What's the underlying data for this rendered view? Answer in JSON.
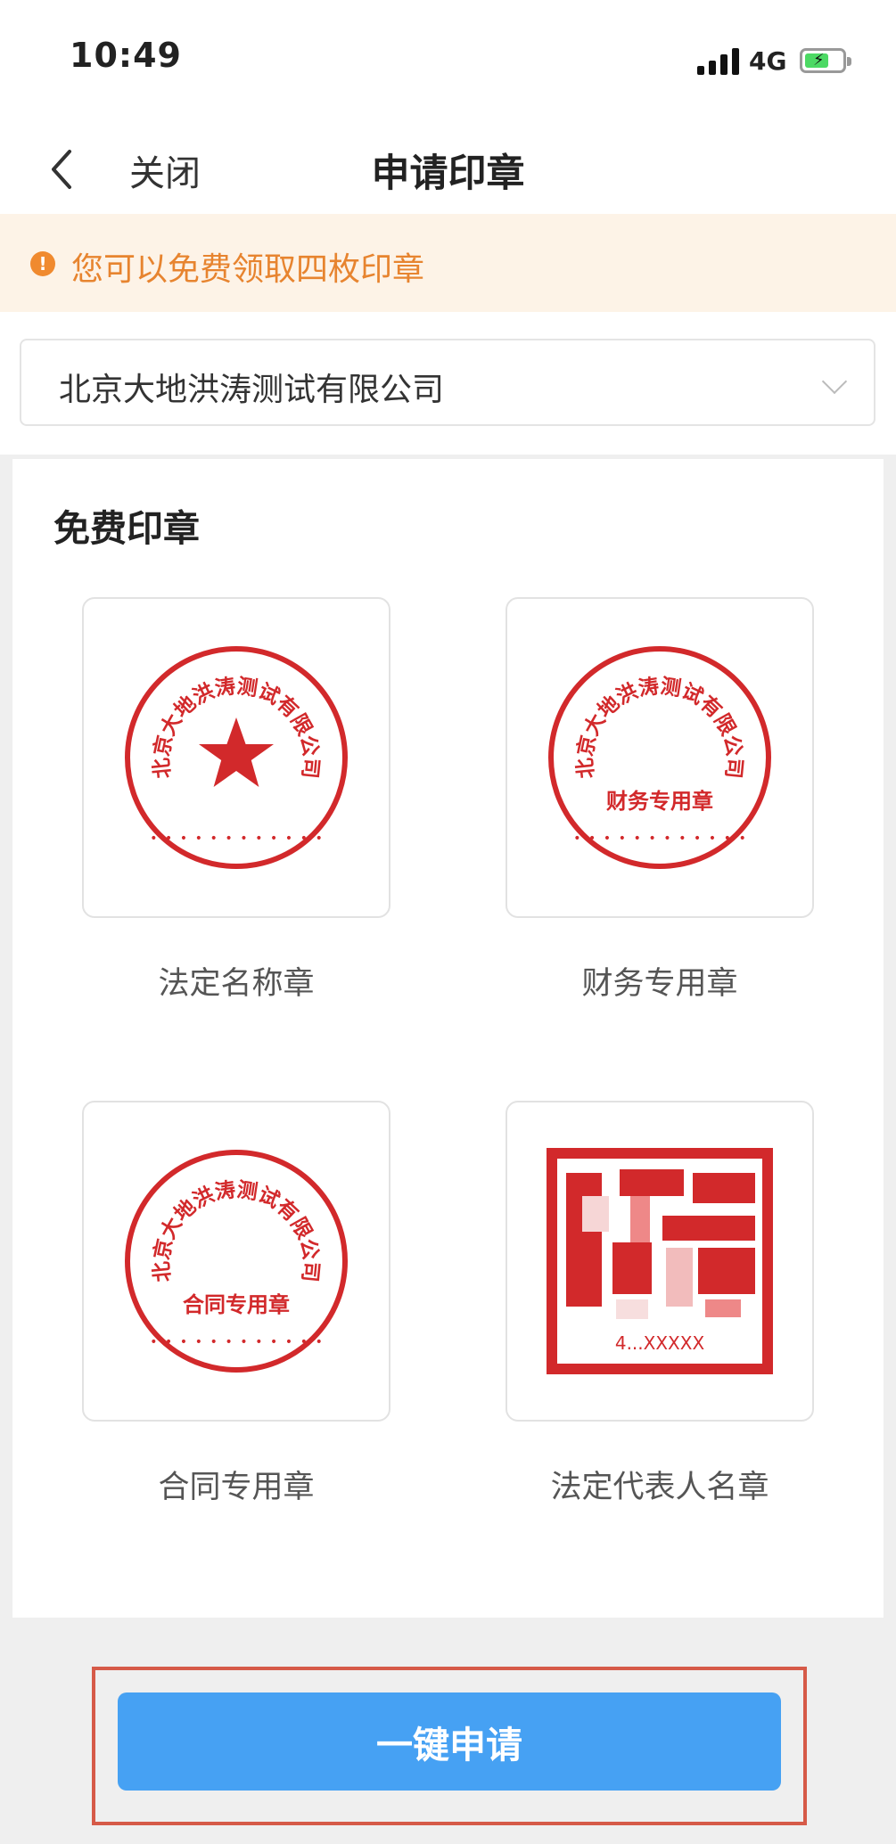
{
  "status_bar": {
    "time": "10:49",
    "network": "4G",
    "battery_icon": "battery-charging-icon"
  },
  "nav": {
    "back_icon": "chevron-left-icon",
    "close_label": "关闭",
    "title": "申请印章"
  },
  "notice": {
    "icon": "warning-icon",
    "text": "您可以免费领取四枚印章"
  },
  "company_select": {
    "value": "北京大地洪涛测试有限公司",
    "icon": "chevron-down-icon"
  },
  "section": {
    "title": "免费印章",
    "seals": [
      {
        "label": "法定名称章",
        "ring_text": "北京大地洪涛测试有限公司",
        "center_text": "",
        "has_star": true
      },
      {
        "label": "财务专用章",
        "ring_text": "北京大地洪涛测试有限公司",
        "center_text": "财务专用章",
        "has_star": false
      },
      {
        "label": "合同专用章",
        "ring_text": "北京大地洪涛测试有限公司",
        "center_text": "合同专用章",
        "has_star": false
      },
      {
        "label": "法定代表人名章",
        "bottom_text": "4...XXXXX"
      }
    ]
  },
  "footer": {
    "apply_label": "一键申请"
  },
  "colors": {
    "seal_red": "#d2292b",
    "button_blue": "#46a1f3",
    "notice_bg": "#fdf3e7",
    "notice_text": "#e7842f",
    "highlight_border": "#d65a48"
  }
}
